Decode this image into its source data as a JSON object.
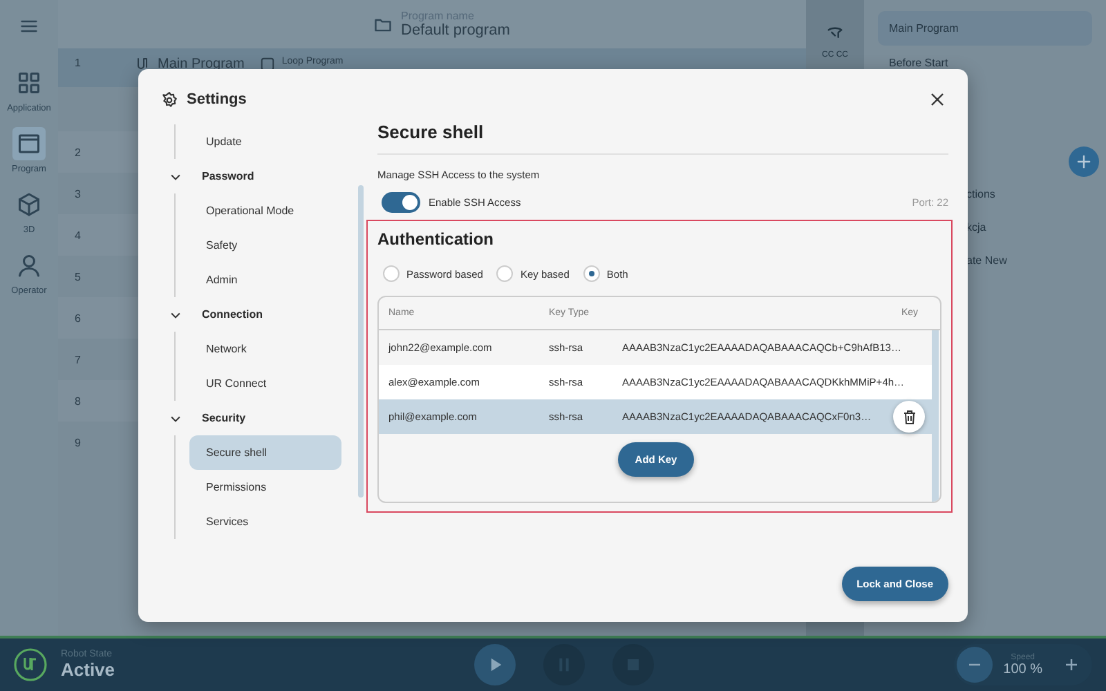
{
  "rail": [
    {
      "label": "Application",
      "selected": false
    },
    {
      "label": "Program",
      "selected": true
    },
    {
      "label": "3D",
      "selected": false
    },
    {
      "label": "Operator",
      "selected": false
    }
  ],
  "header": {
    "caption": "Program name",
    "program": "Default program"
  },
  "program_rows": [
    {
      "number": "1",
      "title": "Main Program",
      "loop": "Loop Program",
      "selected": true
    },
    {
      "number": "2",
      "selected": false
    },
    {
      "number": "3",
      "selected": false
    },
    {
      "number": "4",
      "selected": false
    },
    {
      "number": "5",
      "selected": false
    },
    {
      "number": "6",
      "selected": false
    },
    {
      "number": "7",
      "selected": false
    },
    {
      "number": "8",
      "selected": false
    },
    {
      "number": "9",
      "selected": false
    }
  ],
  "tool_column": {
    "label": "CC CC"
  },
  "right_panel": {
    "items": [
      {
        "label": "Main Program",
        "selected": true
      },
      {
        "label": "Before Start",
        "selected": false
      }
    ],
    "cut_items": [
      "ctions",
      "kcja",
      "ate New"
    ]
  },
  "dialog": {
    "title": "Settings",
    "nav": [
      {
        "kind": "item",
        "label": "Update",
        "selected": false
      },
      {
        "kind": "group",
        "label": "Password",
        "expanded": true,
        "children": [
          {
            "label": "Operational Mode",
            "selected": false
          },
          {
            "label": "Safety",
            "selected": false
          },
          {
            "label": "Admin",
            "selected": false
          }
        ]
      },
      {
        "kind": "group",
        "label": "Connection",
        "expanded": true,
        "children": [
          {
            "label": "Network",
            "selected": false
          },
          {
            "label": "UR Connect",
            "selected": false
          }
        ]
      },
      {
        "kind": "group",
        "label": "Security",
        "expanded": true,
        "children": [
          {
            "label": "Secure shell",
            "selected": true
          },
          {
            "label": "Permissions",
            "selected": false
          },
          {
            "label": "Services",
            "selected": false
          }
        ]
      }
    ],
    "heading": "Secure shell",
    "description": "Manage SSH Access to the system",
    "ssh_toggle": {
      "label": "Enable SSH Access",
      "on": true
    },
    "port": "Port: 22",
    "auth": {
      "title": "Authentication",
      "options": [
        {
          "label": "Password based",
          "selected": false
        },
        {
          "label": "Key based",
          "selected": false
        },
        {
          "label": "Both",
          "selected": true
        }
      ],
      "columns": [
        "Name",
        "Key Type",
        "Key"
      ],
      "rows": [
        {
          "name": "john22@example.com",
          "key_type": "ssh-rsa",
          "key": "AAAAB3NzaC1yc2EAAAADAQABAAACAQCb+C9hAfB13…",
          "selected": false
        },
        {
          "name": "alex@example.com",
          "key_type": "ssh-rsa",
          "key": "AAAAB3NzaC1yc2EAAAADAQABAAACAQDKkhMMiP+4h…",
          "selected": false
        },
        {
          "name": "phil@example.com",
          "key_type": "ssh-rsa",
          "key": "AAAAB3NzaC1yc2EAAAADAQABAAACAQCxF0n3…",
          "selected": true
        }
      ],
      "add_button": "Add Key"
    },
    "close_button": "Lock and Close"
  },
  "bottom_bar": {
    "state_caption": "Robot State",
    "state": "Active",
    "speed_caption": "Speed",
    "speed": "100 %"
  }
}
